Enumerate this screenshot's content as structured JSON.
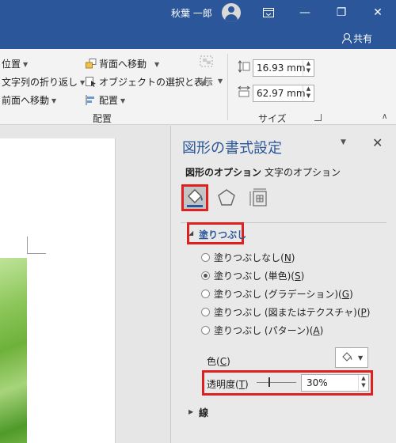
{
  "titlebar": {
    "user_name": "秋葉 一郎",
    "restore_icon": "ribbon-display-icon",
    "minimize": "—",
    "maximize": "❐",
    "close": "✕",
    "share_label": "共有"
  },
  "ribbon": {
    "arrange": {
      "position_label": "位置",
      "wrap_text_label": "文字列の折り返し",
      "bring_forward_label": "前面へ移動",
      "send_backward_label": "背面へ移動",
      "selection_pane_label": "オブジェクトの選択と表示",
      "align_label": "配置",
      "group_label": "配置"
    },
    "size": {
      "height_value": "16.93 mm",
      "width_value": "62.97 mm",
      "group_label": "サイズ"
    }
  },
  "pane": {
    "title": "図形の書式設定",
    "tabs": [
      "図形のオプション",
      "文字のオプション"
    ],
    "categories": [
      "fill-line-icon",
      "effects-pentagon-icon",
      "size-properties-icon"
    ],
    "fill": {
      "section_label": "塗りつぶし",
      "options": [
        {
          "label": "塗りつぶしなし(",
          "key": "N",
          "suffix": ")",
          "selected": false
        },
        {
          "label": "塗りつぶし (単色)(",
          "key": "S",
          "suffix": ")",
          "selected": true
        },
        {
          "label": "塗りつぶし (グラデーション)(",
          "key": "G",
          "suffix": ")",
          "selected": false
        },
        {
          "label": "塗りつぶし (図またはテクスチャ)(",
          "key": "P",
          "suffix": ")",
          "selected": false
        },
        {
          "label": "塗りつぶし (パターン)(",
          "key": "A",
          "suffix": ")",
          "selected": false
        }
      ],
      "color_label": "色(",
      "color_key": "C",
      "color_suffix": ")",
      "transparency_label": "透明度(",
      "transparency_key": "T",
      "transparency_suffix": ")",
      "transparency_value": "30%",
      "transparency_level": 0.3
    },
    "line_section_label": "線"
  },
  "colors": {
    "accent": "#2b579a",
    "highlight": "#e02020"
  }
}
